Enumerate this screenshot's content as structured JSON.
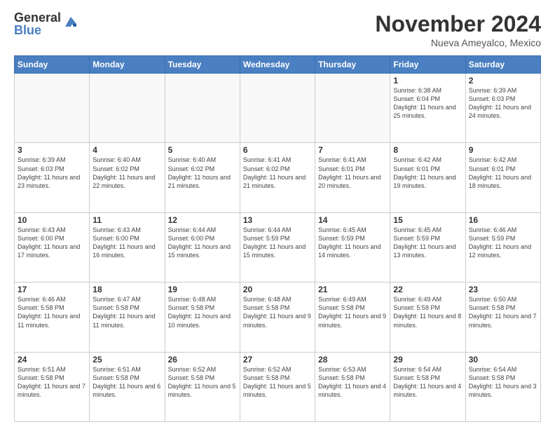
{
  "header": {
    "logo_general": "General",
    "logo_blue": "Blue",
    "month_title": "November 2024",
    "subtitle": "Nueva Ameyalco, Mexico"
  },
  "days_of_week": [
    "Sunday",
    "Monday",
    "Tuesday",
    "Wednesday",
    "Thursday",
    "Friday",
    "Saturday"
  ],
  "weeks": [
    [
      {
        "day": "",
        "info": ""
      },
      {
        "day": "",
        "info": ""
      },
      {
        "day": "",
        "info": ""
      },
      {
        "day": "",
        "info": ""
      },
      {
        "day": "",
        "info": ""
      },
      {
        "day": "1",
        "info": "Sunrise: 6:38 AM\nSunset: 6:04 PM\nDaylight: 11 hours and 25 minutes."
      },
      {
        "day": "2",
        "info": "Sunrise: 6:39 AM\nSunset: 6:03 PM\nDaylight: 11 hours and 24 minutes."
      }
    ],
    [
      {
        "day": "3",
        "info": "Sunrise: 6:39 AM\nSunset: 6:03 PM\nDaylight: 11 hours and 23 minutes."
      },
      {
        "day": "4",
        "info": "Sunrise: 6:40 AM\nSunset: 6:02 PM\nDaylight: 11 hours and 22 minutes."
      },
      {
        "day": "5",
        "info": "Sunrise: 6:40 AM\nSunset: 6:02 PM\nDaylight: 11 hours and 21 minutes."
      },
      {
        "day": "6",
        "info": "Sunrise: 6:41 AM\nSunset: 6:02 PM\nDaylight: 11 hours and 21 minutes."
      },
      {
        "day": "7",
        "info": "Sunrise: 6:41 AM\nSunset: 6:01 PM\nDaylight: 11 hours and 20 minutes."
      },
      {
        "day": "8",
        "info": "Sunrise: 6:42 AM\nSunset: 6:01 PM\nDaylight: 11 hours and 19 minutes."
      },
      {
        "day": "9",
        "info": "Sunrise: 6:42 AM\nSunset: 6:01 PM\nDaylight: 11 hours and 18 minutes."
      }
    ],
    [
      {
        "day": "10",
        "info": "Sunrise: 6:43 AM\nSunset: 6:00 PM\nDaylight: 11 hours and 17 minutes."
      },
      {
        "day": "11",
        "info": "Sunrise: 6:43 AM\nSunset: 6:00 PM\nDaylight: 11 hours and 16 minutes."
      },
      {
        "day": "12",
        "info": "Sunrise: 6:44 AM\nSunset: 6:00 PM\nDaylight: 11 hours and 15 minutes."
      },
      {
        "day": "13",
        "info": "Sunrise: 6:44 AM\nSunset: 5:59 PM\nDaylight: 11 hours and 15 minutes."
      },
      {
        "day": "14",
        "info": "Sunrise: 6:45 AM\nSunset: 5:59 PM\nDaylight: 11 hours and 14 minutes."
      },
      {
        "day": "15",
        "info": "Sunrise: 6:45 AM\nSunset: 5:59 PM\nDaylight: 11 hours and 13 minutes."
      },
      {
        "day": "16",
        "info": "Sunrise: 6:46 AM\nSunset: 5:59 PM\nDaylight: 11 hours and 12 minutes."
      }
    ],
    [
      {
        "day": "17",
        "info": "Sunrise: 6:46 AM\nSunset: 5:58 PM\nDaylight: 11 hours and 11 minutes."
      },
      {
        "day": "18",
        "info": "Sunrise: 6:47 AM\nSunset: 5:58 PM\nDaylight: 11 hours and 11 minutes."
      },
      {
        "day": "19",
        "info": "Sunrise: 6:48 AM\nSunset: 5:58 PM\nDaylight: 11 hours and 10 minutes."
      },
      {
        "day": "20",
        "info": "Sunrise: 6:48 AM\nSunset: 5:58 PM\nDaylight: 11 hours and 9 minutes."
      },
      {
        "day": "21",
        "info": "Sunrise: 6:49 AM\nSunset: 5:58 PM\nDaylight: 11 hours and 9 minutes."
      },
      {
        "day": "22",
        "info": "Sunrise: 6:49 AM\nSunset: 5:58 PM\nDaylight: 11 hours and 8 minutes."
      },
      {
        "day": "23",
        "info": "Sunrise: 6:50 AM\nSunset: 5:58 PM\nDaylight: 11 hours and 7 minutes."
      }
    ],
    [
      {
        "day": "24",
        "info": "Sunrise: 6:51 AM\nSunset: 5:58 PM\nDaylight: 11 hours and 7 minutes."
      },
      {
        "day": "25",
        "info": "Sunrise: 6:51 AM\nSunset: 5:58 PM\nDaylight: 11 hours and 6 minutes."
      },
      {
        "day": "26",
        "info": "Sunrise: 6:52 AM\nSunset: 5:58 PM\nDaylight: 11 hours and 5 minutes."
      },
      {
        "day": "27",
        "info": "Sunrise: 6:52 AM\nSunset: 5:58 PM\nDaylight: 11 hours and 5 minutes."
      },
      {
        "day": "28",
        "info": "Sunrise: 6:53 AM\nSunset: 5:58 PM\nDaylight: 11 hours and 4 minutes."
      },
      {
        "day": "29",
        "info": "Sunrise: 6:54 AM\nSunset: 5:58 PM\nDaylight: 11 hours and 4 minutes."
      },
      {
        "day": "30",
        "info": "Sunrise: 6:54 AM\nSunset: 5:58 PM\nDaylight: 11 hours and 3 minutes."
      }
    ]
  ]
}
